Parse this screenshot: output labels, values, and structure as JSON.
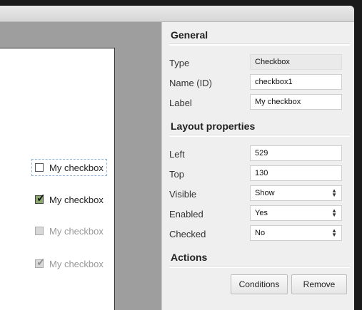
{
  "canvas": {
    "checkboxes": [
      {
        "label": "My checkbox",
        "checked": false,
        "enabled": true,
        "selected": true
      },
      {
        "label": "My checkbox",
        "checked": true,
        "enabled": true,
        "selected": false
      },
      {
        "label": "My checkbox",
        "checked": false,
        "enabled": false,
        "selected": false
      },
      {
        "label": "My checkbox",
        "checked": true,
        "enabled": false,
        "selected": false
      }
    ]
  },
  "panel": {
    "general": {
      "title": "General",
      "type_label": "Type",
      "type_value": "Checkbox",
      "name_label": "Name (ID)",
      "name_value": "checkbox1",
      "label_label": "Label",
      "label_value": "My checkbox"
    },
    "layout": {
      "title": "Layout properties",
      "left_label": "Left",
      "left_value": "529",
      "top_label": "Top",
      "top_value": "130",
      "visible_label": "Visible",
      "visible_value": "Show",
      "enabled_label": "Enabled",
      "enabled_value": "Yes",
      "checked_label": "Checked",
      "checked_value": "No"
    },
    "actions": {
      "title": "Actions",
      "conditions_label": "Conditions",
      "remove_label": "Remove"
    }
  },
  "colors": {
    "checked_fill": "#8aa870",
    "selection_border": "#8fb5d8"
  }
}
